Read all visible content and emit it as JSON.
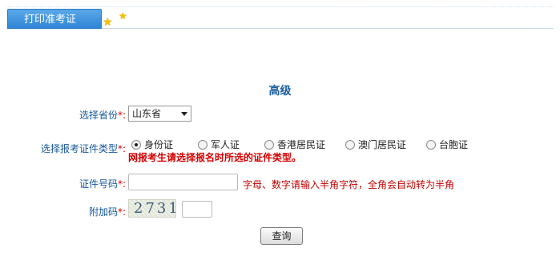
{
  "header": {
    "tab_label": "打印准考证"
  },
  "form": {
    "title": "高级",
    "province": {
      "label": "选择省份",
      "required_mark": "*:",
      "selected": "山东省"
    },
    "id_type": {
      "label": "选择报考证件类型",
      "required_mark": "*:",
      "options": [
        "身份证",
        "军人证",
        "香港居民证",
        "澳门居民证",
        "台胞证"
      ],
      "selected_index": 0,
      "note": "网报考生请选择报名时所选的证件类型。"
    },
    "id_number": {
      "label": "证件号码",
      "required_mark": "*:",
      "value": "",
      "hint": "字母、数字请输入半角字符，全角会自动转为半角"
    },
    "captcha": {
      "label": "附加码",
      "required_mark": "*:",
      "image_text": "2731",
      "value": ""
    },
    "submit_label": "查询"
  }
}
